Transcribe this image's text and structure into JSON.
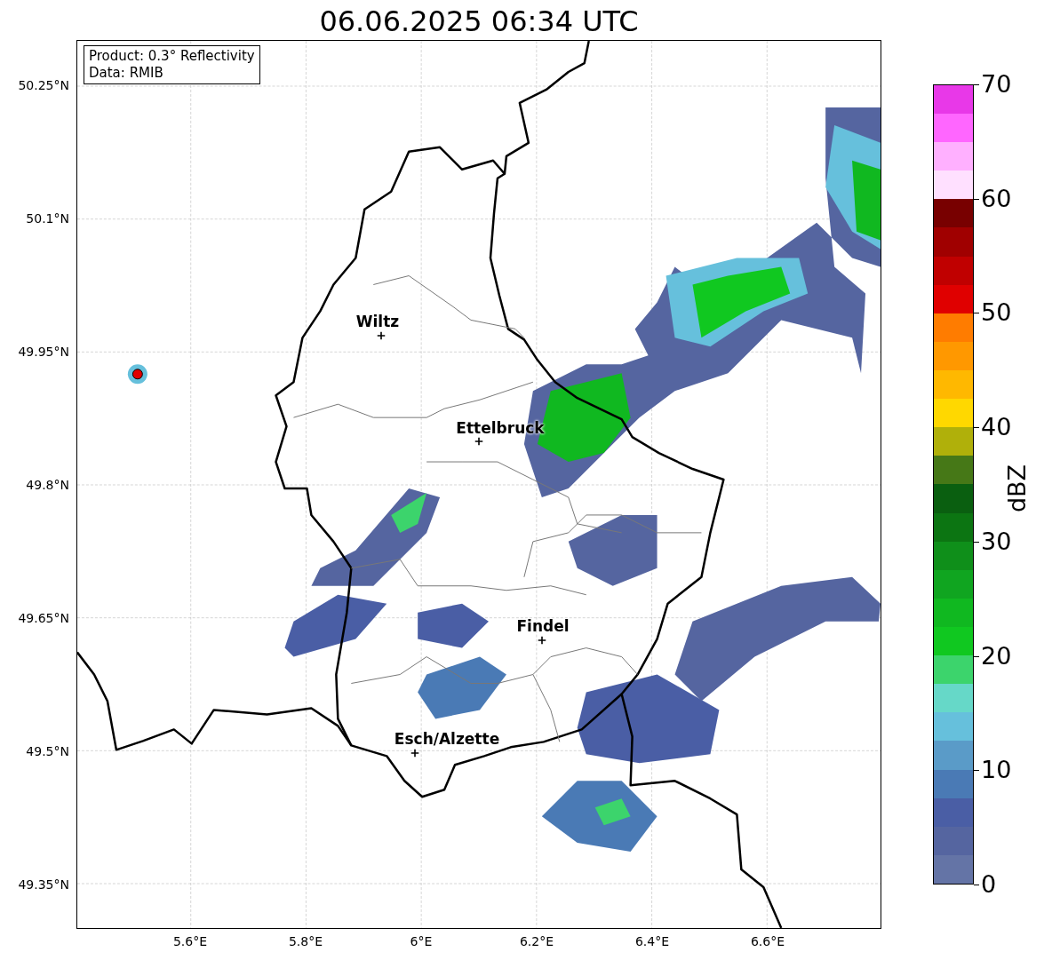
{
  "title": "06.06.2025 06:34 UTC",
  "legend": [
    "Product: 0.3° Reflectivity",
    "Data: RMIB"
  ],
  "y_ticks": [
    "50.25°N",
    "50.1°N",
    "49.95°N",
    "49.8°N",
    "49.65°N",
    "49.5°N",
    "49.35°N"
  ],
  "x_ticks": [
    "5.6°E",
    "5.8°E",
    "6°E",
    "6.2°E",
    "6.4°E",
    "6.6°E"
  ],
  "cities": [
    {
      "name": "Wiltz"
    },
    {
      "name": "Ettelbruck"
    },
    {
      "name": "Findel"
    },
    {
      "name": "Esch/Alzette"
    }
  ],
  "colorbar": {
    "label": "dBZ",
    "ticks": [
      "70",
      "60",
      "50",
      "40",
      "30",
      "20",
      "10",
      "0"
    ],
    "bands": [
      {
        "color": "#6474a6"
      },
      {
        "color": "#5565a0"
      },
      {
        "color": "#4a5ea5"
      },
      {
        "color": "#4a7ab5"
      },
      {
        "color": "#5a9bc8"
      },
      {
        "color": "#66c0dc"
      },
      {
        "color": "#66d8c8"
      },
      {
        "color": "#3cd46c"
      },
      {
        "color": "#10c820"
      },
      {
        "color": "#10b820"
      },
      {
        "color": "#10a520"
      },
      {
        "color": "#0f8f1a"
      },
      {
        "color": "#0c7512"
      },
      {
        "color": "#0a5f10"
      },
      {
        "color": "#467817"
      },
      {
        "color": "#b0b00a"
      },
      {
        "color": "#ffd800"
      },
      {
        "color": "#ffb800"
      },
      {
        "color": "#ff9800"
      },
      {
        "color": "#ff7c00"
      },
      {
        "color": "#e00000"
      },
      {
        "color": "#c00000"
      },
      {
        "color": "#a00000"
      },
      {
        "color": "#780000"
      },
      {
        "color": "#ffe0ff"
      },
      {
        "color": "#ffb0ff"
      },
      {
        "color": "#ff66ff"
      },
      {
        "color": "#e838e8"
      }
    ]
  }
}
